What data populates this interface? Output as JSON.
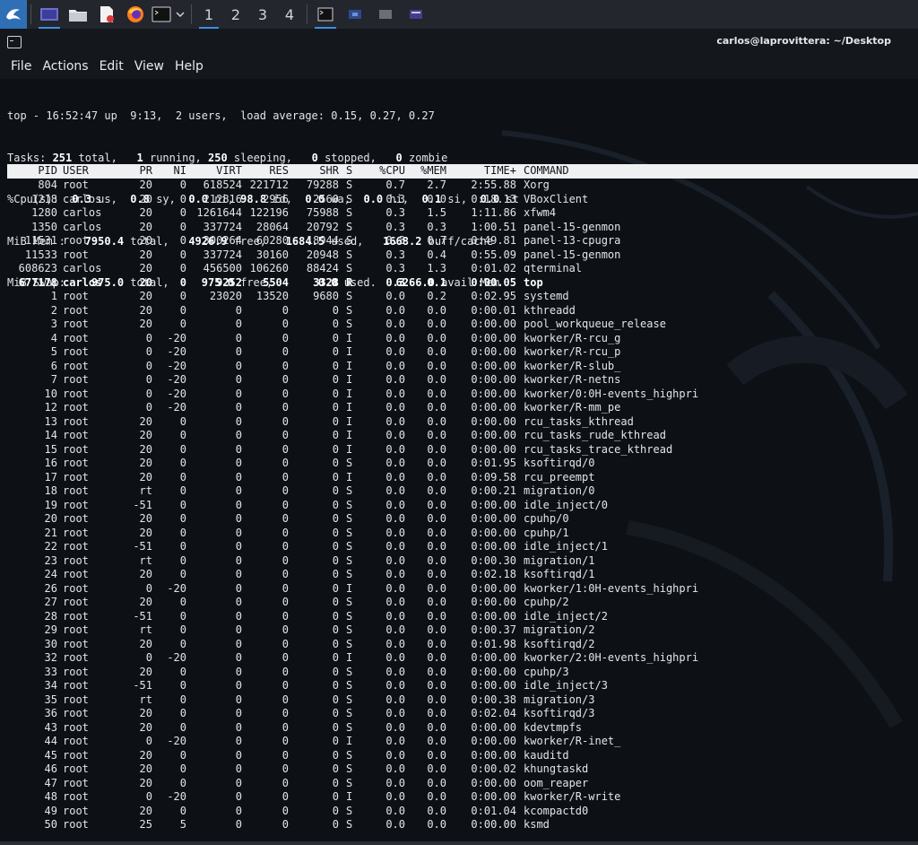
{
  "panel": {
    "workspaces": [
      "1",
      "2",
      "3",
      "4"
    ],
    "active_workspace": "1"
  },
  "window": {
    "title": "carlos@laprovittera: ~/Desktop"
  },
  "menu": [
    "File",
    "Actions",
    "Edit",
    "View",
    "Help"
  ],
  "summary": {
    "line1": "top - 16:52:47 up  9:13,  2 users,  load average: 0.15, 0.27, 0.27",
    "tasks": {
      "label": "Tasks: ",
      "total": "251",
      "total_l": " total,   ",
      "running": "1",
      "running_l": " running, ",
      "sleeping": "250",
      "sleeping_l": " sleeping,   ",
      "stopped": "0",
      "stopped_l": " stopped,   ",
      "zombie": "0",
      "zombie_l": " zombie"
    },
    "cpu": {
      "label": "%Cpu(s):  ",
      "us": "0.3",
      "us_l": " us,  ",
      "sy": "0.8",
      "sy_l": " sy,  ",
      "ni": "0.0",
      "ni_l": " ni, ",
      "id": "98.8",
      "id_l": " id,  ",
      "wa": "0.0",
      "wa_l": " wa,  ",
      "hi": "0.0",
      "hi_l": " hi,  ",
      "si": "0.1",
      "si_l": " si,  ",
      "st": "0.0",
      "st_l": " st"
    },
    "mem": {
      "label": "MiB Mem :   ",
      "total": "7950.4",
      "total_l": " total,   ",
      "free": "4926.9",
      "free_l": " free,   ",
      "used": "1684.5",
      "used_l": " used,   ",
      "buff": "1668.2",
      "buff_l": " buff/cache"
    },
    "swap": {
      "label": "MiB Swap:    ",
      "total": "975.0",
      "total_l": " total,     ",
      "free": "975.0",
      "free_l": " free,       ",
      "used": "0.0",
      "used_l": " used.   ",
      "avail": "6266.0",
      "avail_l": " avail Mem"
    }
  },
  "columns": [
    "PID",
    "USER",
    "PR",
    "NI",
    "VIRT",
    "RES",
    "SHR",
    "S",
    "%CPU",
    "%MEM",
    "TIME+",
    "COMMAND"
  ],
  "processes": [
    [
      "804",
      "root",
      "20",
      "0",
      "618524",
      "221712",
      "79288",
      "S",
      "0.7",
      "2.7",
      "2:55.88",
      "Xorg"
    ],
    [
      "1218",
      "carlos",
      "20",
      "0",
      "212816",
      "2956",
      "2560",
      "S",
      "0.3",
      "0.0",
      "0:18.13",
      "VBoxClient"
    ],
    [
      "1280",
      "carlos",
      "20",
      "0",
      "1261644",
      "122196",
      "75988",
      "S",
      "0.3",
      "1.5",
      "1:11.86",
      "xfwm4"
    ],
    [
      "1350",
      "carlos",
      "20",
      "0",
      "337724",
      "28064",
      "20792",
      "S",
      "0.3",
      "0.3",
      "1:00.51",
      "panel-15-genmon"
    ],
    [
      "11531",
      "root",
      "20",
      "0",
      "300264",
      "60280",
      "18944",
      "S",
      "0.3",
      "0.7",
      "0:49.81",
      "panel-13-cpugra"
    ],
    [
      "11533",
      "root",
      "20",
      "0",
      "337724",
      "30160",
      "20948",
      "S",
      "0.3",
      "0.4",
      "0:55.09",
      "panel-15-genmon"
    ],
    [
      "608623",
      "carlos",
      "20",
      "0",
      "456500",
      "106260",
      "88424",
      "S",
      "0.3",
      "1.3",
      "0:01.02",
      "qterminal"
    ],
    [
      "677178",
      "carlos",
      "20",
      "0",
      "9252",
      "5504",
      "3328",
      "R",
      "0.3",
      "0.1",
      "0:00.05",
      "top"
    ],
    [
      "1",
      "root",
      "20",
      "0",
      "23020",
      "13520",
      "9680",
      "S",
      "0.0",
      "0.2",
      "0:02.95",
      "systemd"
    ],
    [
      "2",
      "root",
      "20",
      "0",
      "0",
      "0",
      "0",
      "S",
      "0.0",
      "0.0",
      "0:00.01",
      "kthreadd"
    ],
    [
      "3",
      "root",
      "20",
      "0",
      "0",
      "0",
      "0",
      "S",
      "0.0",
      "0.0",
      "0:00.00",
      "pool_workqueue_release"
    ],
    [
      "4",
      "root",
      "0",
      "-20",
      "0",
      "0",
      "0",
      "I",
      "0.0",
      "0.0",
      "0:00.00",
      "kworker/R-rcu_g"
    ],
    [
      "5",
      "root",
      "0",
      "-20",
      "0",
      "0",
      "0",
      "I",
      "0.0",
      "0.0",
      "0:00.00",
      "kworker/R-rcu_p"
    ],
    [
      "6",
      "root",
      "0",
      "-20",
      "0",
      "0",
      "0",
      "I",
      "0.0",
      "0.0",
      "0:00.00",
      "kworker/R-slub_"
    ],
    [
      "7",
      "root",
      "0",
      "-20",
      "0",
      "0",
      "0",
      "I",
      "0.0",
      "0.0",
      "0:00.00",
      "kworker/R-netns"
    ],
    [
      "10",
      "root",
      "0",
      "-20",
      "0",
      "0",
      "0",
      "I",
      "0.0",
      "0.0",
      "0:00.00",
      "kworker/0:0H-events_highpri"
    ],
    [
      "12",
      "root",
      "0",
      "-20",
      "0",
      "0",
      "0",
      "I",
      "0.0",
      "0.0",
      "0:00.00",
      "kworker/R-mm_pe"
    ],
    [
      "13",
      "root",
      "20",
      "0",
      "0",
      "0",
      "0",
      "I",
      "0.0",
      "0.0",
      "0:00.00",
      "rcu_tasks_kthread"
    ],
    [
      "14",
      "root",
      "20",
      "0",
      "0",
      "0",
      "0",
      "I",
      "0.0",
      "0.0",
      "0:00.00",
      "rcu_tasks_rude_kthread"
    ],
    [
      "15",
      "root",
      "20",
      "0",
      "0",
      "0",
      "0",
      "I",
      "0.0",
      "0.0",
      "0:00.00",
      "rcu_tasks_trace_kthread"
    ],
    [
      "16",
      "root",
      "20",
      "0",
      "0",
      "0",
      "0",
      "S",
      "0.0",
      "0.0",
      "0:01.95",
      "ksoftirqd/0"
    ],
    [
      "17",
      "root",
      "20",
      "0",
      "0",
      "0",
      "0",
      "I",
      "0.0",
      "0.0",
      "0:09.58",
      "rcu_preempt"
    ],
    [
      "18",
      "root",
      "rt",
      "0",
      "0",
      "0",
      "0",
      "S",
      "0.0",
      "0.0",
      "0:00.21",
      "migration/0"
    ],
    [
      "19",
      "root",
      "-51",
      "0",
      "0",
      "0",
      "0",
      "S",
      "0.0",
      "0.0",
      "0:00.00",
      "idle_inject/0"
    ],
    [
      "20",
      "root",
      "20",
      "0",
      "0",
      "0",
      "0",
      "S",
      "0.0",
      "0.0",
      "0:00.00",
      "cpuhp/0"
    ],
    [
      "21",
      "root",
      "20",
      "0",
      "0",
      "0",
      "0",
      "S",
      "0.0",
      "0.0",
      "0:00.00",
      "cpuhp/1"
    ],
    [
      "22",
      "root",
      "-51",
      "0",
      "0",
      "0",
      "0",
      "S",
      "0.0",
      "0.0",
      "0:00.00",
      "idle_inject/1"
    ],
    [
      "23",
      "root",
      "rt",
      "0",
      "0",
      "0",
      "0",
      "S",
      "0.0",
      "0.0",
      "0:00.30",
      "migration/1"
    ],
    [
      "24",
      "root",
      "20",
      "0",
      "0",
      "0",
      "0",
      "S",
      "0.0",
      "0.0",
      "0:02.18",
      "ksoftirqd/1"
    ],
    [
      "26",
      "root",
      "0",
      "-20",
      "0",
      "0",
      "0",
      "I",
      "0.0",
      "0.0",
      "0:00.00",
      "kworker/1:0H-events_highpri"
    ],
    [
      "27",
      "root",
      "20",
      "0",
      "0",
      "0",
      "0",
      "S",
      "0.0",
      "0.0",
      "0:00.00",
      "cpuhp/2"
    ],
    [
      "28",
      "root",
      "-51",
      "0",
      "0",
      "0",
      "0",
      "S",
      "0.0",
      "0.0",
      "0:00.00",
      "idle_inject/2"
    ],
    [
      "29",
      "root",
      "rt",
      "0",
      "0",
      "0",
      "0",
      "S",
      "0.0",
      "0.0",
      "0:00.37",
      "migration/2"
    ],
    [
      "30",
      "root",
      "20",
      "0",
      "0",
      "0",
      "0",
      "S",
      "0.0",
      "0.0",
      "0:01.98",
      "ksoftirqd/2"
    ],
    [
      "32",
      "root",
      "0",
      "-20",
      "0",
      "0",
      "0",
      "I",
      "0.0",
      "0.0",
      "0:00.00",
      "kworker/2:0H-events_highpri"
    ],
    [
      "33",
      "root",
      "20",
      "0",
      "0",
      "0",
      "0",
      "S",
      "0.0",
      "0.0",
      "0:00.00",
      "cpuhp/3"
    ],
    [
      "34",
      "root",
      "-51",
      "0",
      "0",
      "0",
      "0",
      "S",
      "0.0",
      "0.0",
      "0:00.00",
      "idle_inject/3"
    ],
    [
      "35",
      "root",
      "rt",
      "0",
      "0",
      "0",
      "0",
      "S",
      "0.0",
      "0.0",
      "0:00.38",
      "migration/3"
    ],
    [
      "36",
      "root",
      "20",
      "0",
      "0",
      "0",
      "0",
      "S",
      "0.0",
      "0.0",
      "0:02.04",
      "ksoftirqd/3"
    ],
    [
      "43",
      "root",
      "20",
      "0",
      "0",
      "0",
      "0",
      "S",
      "0.0",
      "0.0",
      "0:00.00",
      "kdevtmpfs"
    ],
    [
      "44",
      "root",
      "0",
      "-20",
      "0",
      "0",
      "0",
      "I",
      "0.0",
      "0.0",
      "0:00.00",
      "kworker/R-inet_"
    ],
    [
      "45",
      "root",
      "20",
      "0",
      "0",
      "0",
      "0",
      "S",
      "0.0",
      "0.0",
      "0:00.00",
      "kauditd"
    ],
    [
      "46",
      "root",
      "20",
      "0",
      "0",
      "0",
      "0",
      "S",
      "0.0",
      "0.0",
      "0:00.02",
      "khungtaskd"
    ],
    [
      "47",
      "root",
      "20",
      "0",
      "0",
      "0",
      "0",
      "S",
      "0.0",
      "0.0",
      "0:00.00",
      "oom_reaper"
    ],
    [
      "48",
      "root",
      "0",
      "-20",
      "0",
      "0",
      "0",
      "I",
      "0.0",
      "0.0",
      "0:00.00",
      "kworker/R-write"
    ],
    [
      "49",
      "root",
      "20",
      "0",
      "0",
      "0",
      "0",
      "S",
      "0.0",
      "0.0",
      "0:01.04",
      "kcompactd0"
    ],
    [
      "50",
      "root",
      "25",
      "5",
      "0",
      "0",
      "0",
      "S",
      "0.0",
      "0.0",
      "0:00.00",
      "ksmd"
    ]
  ],
  "highlight_pid": "677178",
  "colors": {
    "panel": "#23262d",
    "terminal_bg": "#0d1116",
    "accent": "#3d8ee3",
    "header_bg": "#eef0f2"
  }
}
